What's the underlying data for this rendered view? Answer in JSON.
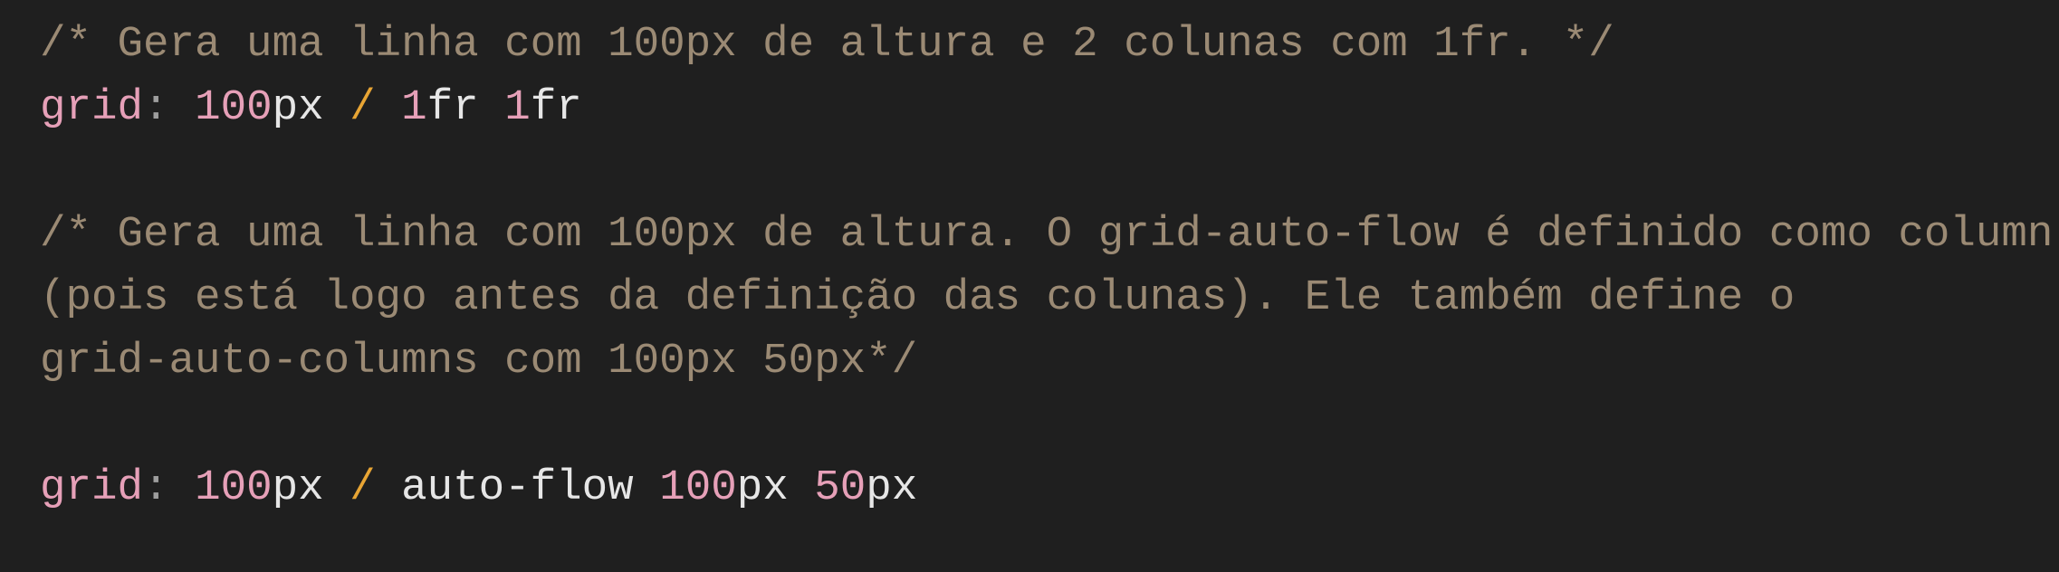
{
  "code": {
    "comment1": "/* Gera uma linha com 100px de altura e 2 colunas com 1fr. */",
    "line2": {
      "prop": "grid",
      "colon": ":",
      "n1": "100",
      "u1": "px",
      "slash": "/",
      "n2": "1",
      "u2": "fr",
      "n3": "1",
      "u3": "fr"
    },
    "comment2_line1": "/* Gera uma linha com 100px de altura. O grid-auto-flow é definido como column",
    "comment2_line2": "(pois está logo antes da definição das colunas). Ele também define o",
    "comment2_line3": "grid-auto-columns com 100px 50px*/",
    "line8": {
      "prop": "grid",
      "colon": ":",
      "n1": "100",
      "u1": "px",
      "slash": "/",
      "kw": "auto-flow",
      "n2": "100",
      "u2": "px",
      "n3": "50",
      "u3": "px"
    }
  },
  "colors": {
    "background": "#1f1f1f",
    "comment": "#9b8a74",
    "property": "#e6a0b8",
    "number": "#e6a0b8",
    "slash": "#e8a534",
    "text": "#e6e6e6"
  }
}
